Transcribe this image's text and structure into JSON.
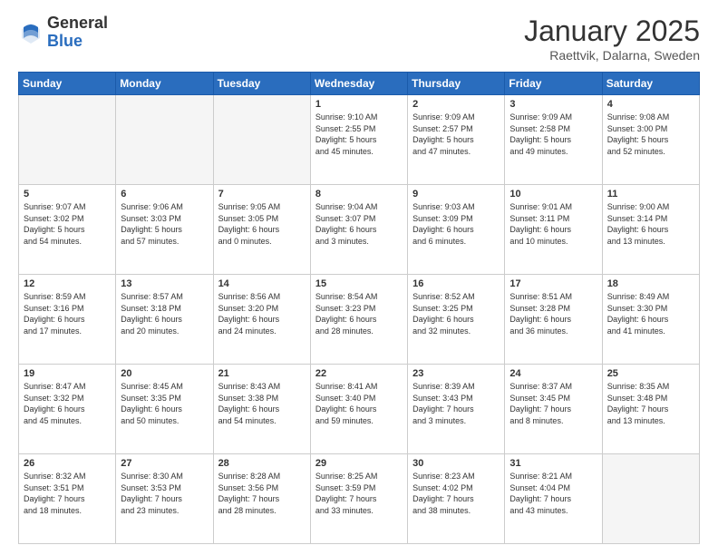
{
  "header": {
    "logo_general": "General",
    "logo_blue": "Blue",
    "month_title": "January 2025",
    "location": "Raettvik, Dalarna, Sweden"
  },
  "days_of_week": [
    "Sunday",
    "Monday",
    "Tuesday",
    "Wednesday",
    "Thursday",
    "Friday",
    "Saturday"
  ],
  "weeks": [
    [
      {
        "day": "",
        "info": ""
      },
      {
        "day": "",
        "info": ""
      },
      {
        "day": "",
        "info": ""
      },
      {
        "day": "1",
        "info": "Sunrise: 9:10 AM\nSunset: 2:55 PM\nDaylight: 5 hours\nand 45 minutes."
      },
      {
        "day": "2",
        "info": "Sunrise: 9:09 AM\nSunset: 2:57 PM\nDaylight: 5 hours\nand 47 minutes."
      },
      {
        "day": "3",
        "info": "Sunrise: 9:09 AM\nSunset: 2:58 PM\nDaylight: 5 hours\nand 49 minutes."
      },
      {
        "day": "4",
        "info": "Sunrise: 9:08 AM\nSunset: 3:00 PM\nDaylight: 5 hours\nand 52 minutes."
      }
    ],
    [
      {
        "day": "5",
        "info": "Sunrise: 9:07 AM\nSunset: 3:02 PM\nDaylight: 5 hours\nand 54 minutes."
      },
      {
        "day": "6",
        "info": "Sunrise: 9:06 AM\nSunset: 3:03 PM\nDaylight: 5 hours\nand 57 minutes."
      },
      {
        "day": "7",
        "info": "Sunrise: 9:05 AM\nSunset: 3:05 PM\nDaylight: 6 hours\nand 0 minutes."
      },
      {
        "day": "8",
        "info": "Sunrise: 9:04 AM\nSunset: 3:07 PM\nDaylight: 6 hours\nand 3 minutes."
      },
      {
        "day": "9",
        "info": "Sunrise: 9:03 AM\nSunset: 3:09 PM\nDaylight: 6 hours\nand 6 minutes."
      },
      {
        "day": "10",
        "info": "Sunrise: 9:01 AM\nSunset: 3:11 PM\nDaylight: 6 hours\nand 10 minutes."
      },
      {
        "day": "11",
        "info": "Sunrise: 9:00 AM\nSunset: 3:14 PM\nDaylight: 6 hours\nand 13 minutes."
      }
    ],
    [
      {
        "day": "12",
        "info": "Sunrise: 8:59 AM\nSunset: 3:16 PM\nDaylight: 6 hours\nand 17 minutes."
      },
      {
        "day": "13",
        "info": "Sunrise: 8:57 AM\nSunset: 3:18 PM\nDaylight: 6 hours\nand 20 minutes."
      },
      {
        "day": "14",
        "info": "Sunrise: 8:56 AM\nSunset: 3:20 PM\nDaylight: 6 hours\nand 24 minutes."
      },
      {
        "day": "15",
        "info": "Sunrise: 8:54 AM\nSunset: 3:23 PM\nDaylight: 6 hours\nand 28 minutes."
      },
      {
        "day": "16",
        "info": "Sunrise: 8:52 AM\nSunset: 3:25 PM\nDaylight: 6 hours\nand 32 minutes."
      },
      {
        "day": "17",
        "info": "Sunrise: 8:51 AM\nSunset: 3:28 PM\nDaylight: 6 hours\nand 36 minutes."
      },
      {
        "day": "18",
        "info": "Sunrise: 8:49 AM\nSunset: 3:30 PM\nDaylight: 6 hours\nand 41 minutes."
      }
    ],
    [
      {
        "day": "19",
        "info": "Sunrise: 8:47 AM\nSunset: 3:32 PM\nDaylight: 6 hours\nand 45 minutes."
      },
      {
        "day": "20",
        "info": "Sunrise: 8:45 AM\nSunset: 3:35 PM\nDaylight: 6 hours\nand 50 minutes."
      },
      {
        "day": "21",
        "info": "Sunrise: 8:43 AM\nSunset: 3:38 PM\nDaylight: 6 hours\nand 54 minutes."
      },
      {
        "day": "22",
        "info": "Sunrise: 8:41 AM\nSunset: 3:40 PM\nDaylight: 6 hours\nand 59 minutes."
      },
      {
        "day": "23",
        "info": "Sunrise: 8:39 AM\nSunset: 3:43 PM\nDaylight: 7 hours\nand 3 minutes."
      },
      {
        "day": "24",
        "info": "Sunrise: 8:37 AM\nSunset: 3:45 PM\nDaylight: 7 hours\nand 8 minutes."
      },
      {
        "day": "25",
        "info": "Sunrise: 8:35 AM\nSunset: 3:48 PM\nDaylight: 7 hours\nand 13 minutes."
      }
    ],
    [
      {
        "day": "26",
        "info": "Sunrise: 8:32 AM\nSunset: 3:51 PM\nDaylight: 7 hours\nand 18 minutes."
      },
      {
        "day": "27",
        "info": "Sunrise: 8:30 AM\nSunset: 3:53 PM\nDaylight: 7 hours\nand 23 minutes."
      },
      {
        "day": "28",
        "info": "Sunrise: 8:28 AM\nSunset: 3:56 PM\nDaylight: 7 hours\nand 28 minutes."
      },
      {
        "day": "29",
        "info": "Sunrise: 8:25 AM\nSunset: 3:59 PM\nDaylight: 7 hours\nand 33 minutes."
      },
      {
        "day": "30",
        "info": "Sunrise: 8:23 AM\nSunset: 4:02 PM\nDaylight: 7 hours\nand 38 minutes."
      },
      {
        "day": "31",
        "info": "Sunrise: 8:21 AM\nSunset: 4:04 PM\nDaylight: 7 hours\nand 43 minutes."
      },
      {
        "day": "",
        "info": ""
      }
    ]
  ]
}
